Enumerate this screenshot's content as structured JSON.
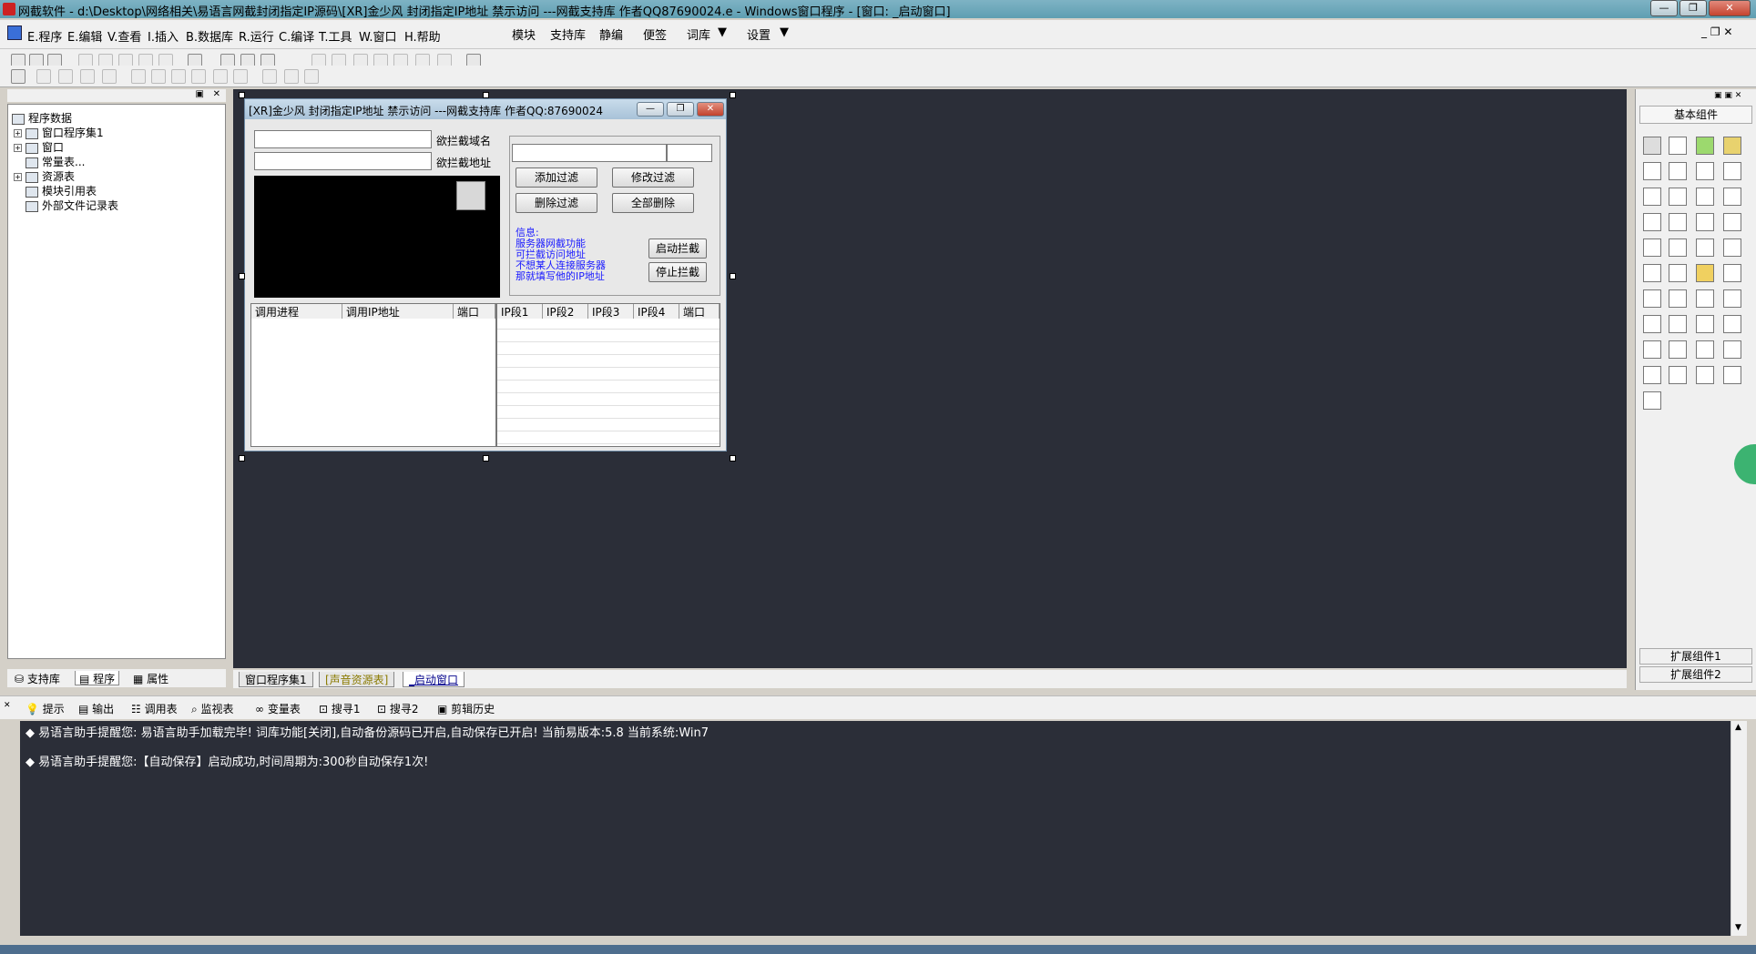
{
  "window": {
    "title": "网截软件 - d:\\Desktop\\网络相关\\易语言网截封闭指定IP源码\\[XR]金少风 封闭指定IP地址 禁示访问 ---网截支持库 作者QQ87690024.e - Windows窗口程序 - [窗口: _启动窗口]",
    "minimize": "—",
    "maximize": "❐",
    "close": "✕"
  },
  "menu": {
    "items": [
      "E.程序",
      "E.编辑",
      "V.查看",
      "I.插入",
      "B.数据库",
      "R.运行",
      "C.编译",
      "T.工具",
      "W.窗口",
      "H.帮助"
    ],
    "extra": [
      "模块",
      "支持库",
      "静编",
      "便签",
      "词库",
      "设置"
    ]
  },
  "tree": {
    "root": "程序数据",
    "items": [
      "窗口程序集1",
      "窗口",
      "常量表...",
      "资源表",
      "模块引用表",
      "外部文件记录表"
    ]
  },
  "left_tabs": [
    "支持库",
    "程序",
    "属性"
  ],
  "designer": {
    "title": "[XR]金少风 封闭指定IP地址 禁示访问 ---网截支持库 作者QQ:87690024",
    "domain_label": "欲拦截域名",
    "address_label": "欲拦截地址",
    "buttons": {
      "add_filter": "添加过滤",
      "edit_filter": "修改过滤",
      "delete_filter": "删除过滤",
      "delete_all": "全部删除",
      "start": "启动拦截",
      "stop": "停止拦截"
    },
    "info_lines": [
      "信息:",
      "服务器网截功能",
      "可拦截访问地址",
      "不想某人连接服务器",
      "那就填写他的IP地址"
    ],
    "left_columns": [
      "调用进程",
      "调用IP地址",
      "端口"
    ],
    "right_columns": [
      "IP段1",
      "IP段2",
      "IP段3",
      "IP段4",
      "端口"
    ]
  },
  "right_panel": {
    "title": "基本组件",
    "ext1": "扩展组件1",
    "ext2": "扩展组件2"
  },
  "editor_tabs": [
    "窗口程序集1",
    "[声音资源表]",
    "_启动窗口"
  ],
  "output_tabs": [
    "提示",
    "输出",
    "调用表",
    "监视表",
    "变量表",
    "搜寻1",
    "搜寻2",
    "剪辑历史"
  ],
  "output_lines": [
    "易语言助手提醒您:  易语言助手加载完毕!  词库功能[关闭],自动备份源码已开启,自动保存已开启!  当前易版本:5.8  当前系统:Win7",
    "易语言助手提醒您:【自动保存】启动成功,时间周期为:300秒自动保存1次!"
  ]
}
